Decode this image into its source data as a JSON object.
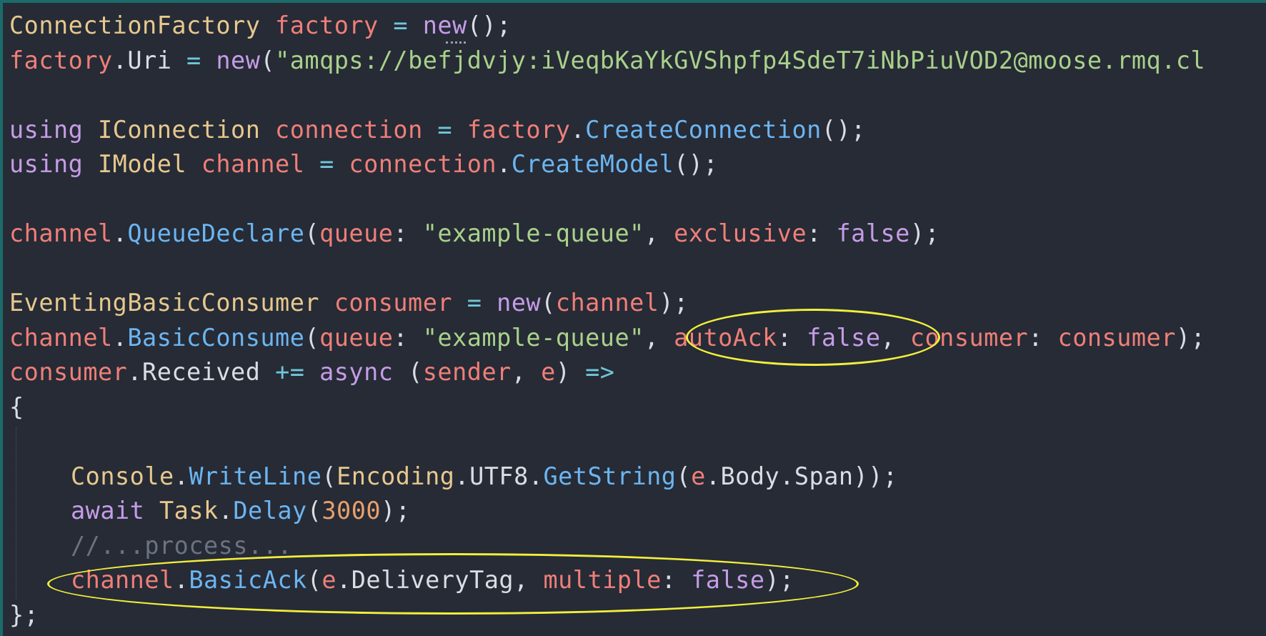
{
  "editor": {
    "lines": [
      {
        "id": "l1",
        "tokens": [
          {
            "t": "type",
            "v": "ConnectionFactory"
          },
          {
            "t": "plain",
            "v": " "
          },
          {
            "t": "var",
            "v": "factory"
          },
          {
            "t": "plain",
            "v": " "
          },
          {
            "t": "op",
            "v": "="
          },
          {
            "t": "plain",
            "v": " "
          },
          {
            "t": "kw",
            "v": "new"
          },
          {
            "t": "punct",
            "v": "();"
          }
        ]
      },
      {
        "id": "l2",
        "tokens": [
          {
            "t": "var",
            "v": "factory"
          },
          {
            "t": "punct",
            "v": "."
          },
          {
            "t": "plain",
            "v": "Uri"
          },
          {
            "t": "plain",
            "v": " "
          },
          {
            "t": "op",
            "v": "="
          },
          {
            "t": "plain",
            "v": " "
          },
          {
            "t": "kw",
            "v": "new"
          },
          {
            "t": "punct",
            "v": "("
          },
          {
            "t": "str",
            "v": "\"amqps://befjdvjy:iVeqbKaYkGVShpfp4SdeT7iNbPiuVOD2@moose.rmq.cl"
          }
        ]
      },
      {
        "id": "l3",
        "tokens": []
      },
      {
        "id": "l4",
        "tokens": [
          {
            "t": "kw",
            "v": "using"
          },
          {
            "t": "plain",
            "v": " "
          },
          {
            "t": "type",
            "v": "IConnection"
          },
          {
            "t": "plain",
            "v": " "
          },
          {
            "t": "var",
            "v": "connection"
          },
          {
            "t": "plain",
            "v": " "
          },
          {
            "t": "op",
            "v": "="
          },
          {
            "t": "plain",
            "v": " "
          },
          {
            "t": "var",
            "v": "factory"
          },
          {
            "t": "punct",
            "v": "."
          },
          {
            "t": "method",
            "v": "CreateConnection"
          },
          {
            "t": "punct",
            "v": "();"
          }
        ]
      },
      {
        "id": "l5",
        "tokens": [
          {
            "t": "kw",
            "v": "using"
          },
          {
            "t": "plain",
            "v": " "
          },
          {
            "t": "type",
            "v": "IModel"
          },
          {
            "t": "plain",
            "v": " "
          },
          {
            "t": "var",
            "v": "channel"
          },
          {
            "t": "plain",
            "v": " "
          },
          {
            "t": "op",
            "v": "="
          },
          {
            "t": "plain",
            "v": " "
          },
          {
            "t": "var",
            "v": "connection"
          },
          {
            "t": "punct",
            "v": "."
          },
          {
            "t": "method",
            "v": "CreateModel"
          },
          {
            "t": "punct",
            "v": "();"
          }
        ]
      },
      {
        "id": "l6",
        "tokens": []
      },
      {
        "id": "l7",
        "tokens": [
          {
            "t": "var",
            "v": "channel"
          },
          {
            "t": "punct",
            "v": "."
          },
          {
            "t": "method",
            "v": "QueueDeclare"
          },
          {
            "t": "punct",
            "v": "("
          },
          {
            "t": "param",
            "v": "queue"
          },
          {
            "t": "punct",
            "v": ": "
          },
          {
            "t": "str",
            "v": "\"example-queue\""
          },
          {
            "t": "punct",
            "v": ", "
          },
          {
            "t": "param",
            "v": "exclusive"
          },
          {
            "t": "punct",
            "v": ": "
          },
          {
            "t": "kw",
            "v": "false"
          },
          {
            "t": "punct",
            "v": ");"
          }
        ]
      },
      {
        "id": "l8",
        "tokens": []
      },
      {
        "id": "l9",
        "tokens": [
          {
            "t": "type",
            "v": "EventingBasicConsumer"
          },
          {
            "t": "plain",
            "v": " "
          },
          {
            "t": "var",
            "v": "consumer"
          },
          {
            "t": "plain",
            "v": " "
          },
          {
            "t": "op",
            "v": "="
          },
          {
            "t": "plain",
            "v": " "
          },
          {
            "t": "kw",
            "v": "new"
          },
          {
            "t": "punct",
            "v": "("
          },
          {
            "t": "var",
            "v": "channel"
          },
          {
            "t": "punct",
            "v": ");"
          }
        ]
      },
      {
        "id": "l10",
        "tokens": [
          {
            "t": "var",
            "v": "channel"
          },
          {
            "t": "punct",
            "v": "."
          },
          {
            "t": "method",
            "v": "BasicConsume"
          },
          {
            "t": "punct",
            "v": "("
          },
          {
            "t": "param",
            "v": "queue"
          },
          {
            "t": "punct",
            "v": ": "
          },
          {
            "t": "str",
            "v": "\"example-queue\""
          },
          {
            "t": "punct",
            "v": ", "
          },
          {
            "t": "param",
            "v": "autoAck"
          },
          {
            "t": "punct",
            "v": ": "
          },
          {
            "t": "kw",
            "v": "false"
          },
          {
            "t": "punct",
            "v": ", "
          },
          {
            "t": "param",
            "v": "consumer"
          },
          {
            "t": "punct",
            "v": ": "
          },
          {
            "t": "var",
            "v": "consumer"
          },
          {
            "t": "punct",
            "v": ");"
          }
        ]
      },
      {
        "id": "l11",
        "tokens": [
          {
            "t": "var",
            "v": "consumer"
          },
          {
            "t": "punct",
            "v": "."
          },
          {
            "t": "plain",
            "v": "Received"
          },
          {
            "t": "plain",
            "v": " "
          },
          {
            "t": "op",
            "v": "+="
          },
          {
            "t": "plain",
            "v": " "
          },
          {
            "t": "kw",
            "v": "async"
          },
          {
            "t": "plain",
            "v": " "
          },
          {
            "t": "punct",
            "v": "("
          },
          {
            "t": "var",
            "v": "sender"
          },
          {
            "t": "punct",
            "v": ", "
          },
          {
            "t": "var",
            "v": "e"
          },
          {
            "t": "punct",
            "v": ")"
          },
          {
            "t": "plain",
            "v": " "
          },
          {
            "t": "op",
            "v": "=>"
          }
        ]
      },
      {
        "id": "l12",
        "tokens": [
          {
            "t": "punct",
            "v": "{"
          }
        ]
      },
      {
        "id": "l13",
        "tokens": []
      },
      {
        "id": "l14",
        "indent": true,
        "tokens": [
          {
            "t": "type",
            "v": "Console"
          },
          {
            "t": "punct",
            "v": "."
          },
          {
            "t": "method",
            "v": "WriteLine"
          },
          {
            "t": "punct",
            "v": "("
          },
          {
            "t": "type",
            "v": "Encoding"
          },
          {
            "t": "punct",
            "v": "."
          },
          {
            "t": "plain",
            "v": "UTF8"
          },
          {
            "t": "punct",
            "v": "."
          },
          {
            "t": "method",
            "v": "GetString"
          },
          {
            "t": "punct",
            "v": "("
          },
          {
            "t": "var",
            "v": "e"
          },
          {
            "t": "punct",
            "v": "."
          },
          {
            "t": "plain",
            "v": "Body"
          },
          {
            "t": "punct",
            "v": "."
          },
          {
            "t": "plain",
            "v": "Span"
          },
          {
            "t": "punct",
            "v": "));"
          }
        ]
      },
      {
        "id": "l15",
        "indent": true,
        "tokens": [
          {
            "t": "kw",
            "v": "await"
          },
          {
            "t": "plain",
            "v": " "
          },
          {
            "t": "type",
            "v": "Task"
          },
          {
            "t": "punct",
            "v": "."
          },
          {
            "t": "method",
            "v": "Delay"
          },
          {
            "t": "punct",
            "v": "("
          },
          {
            "t": "num",
            "v": "3000"
          },
          {
            "t": "punct",
            "v": ");"
          }
        ]
      },
      {
        "id": "l16",
        "indent": true,
        "tokens": [
          {
            "t": "comment",
            "v": "//...process..."
          }
        ]
      },
      {
        "id": "l17",
        "indent": true,
        "tokens": [
          {
            "t": "var",
            "v": "channel"
          },
          {
            "t": "punct",
            "v": "."
          },
          {
            "t": "method",
            "v": "BasicAck"
          },
          {
            "t": "punct",
            "v": "("
          },
          {
            "t": "var",
            "v": "e"
          },
          {
            "t": "punct",
            "v": "."
          },
          {
            "t": "plain",
            "v": "DeliveryTag"
          },
          {
            "t": "punct",
            "v": ", "
          },
          {
            "t": "param",
            "v": "multiple"
          },
          {
            "t": "punct",
            "v": ": "
          },
          {
            "t": "kw",
            "v": "false"
          },
          {
            "t": "punct",
            "v": ");"
          }
        ]
      },
      {
        "id": "l18",
        "tokens": [
          {
            "t": "punct",
            "v": "};"
          }
        ]
      }
    ]
  },
  "annotations": {
    "highlight_color": "#f2ee3c",
    "autoack_note": "autoAck: false",
    "basicack_note": "channel.BasicAck(e.DeliveryTag, multiple: false);"
  }
}
